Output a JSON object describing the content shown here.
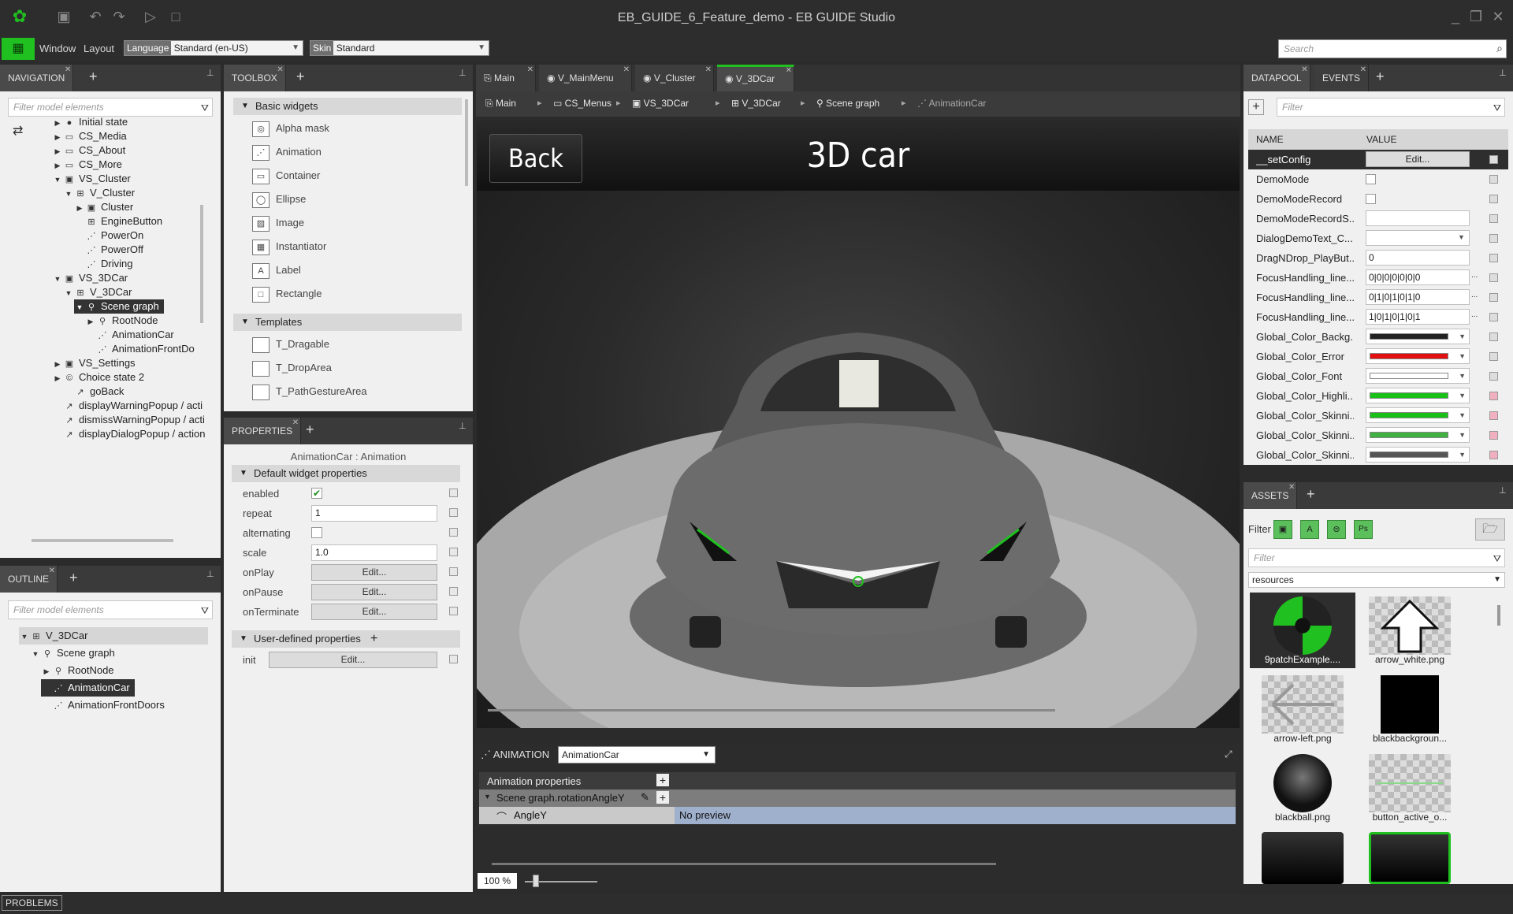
{
  "app": {
    "title": "EB_GUIDE_6_Feature_demo - EB GUIDE Studio"
  },
  "menubar": {
    "window": "Window",
    "layout": "Layout",
    "language_label": "Language",
    "language_value": "Standard (en-US)",
    "skin_label": "Skin",
    "skin_value": "Standard",
    "search_placeholder": "Search"
  },
  "navigation": {
    "tab": "NAVIGATION",
    "filter_placeholder": "Filter model elements",
    "items": [
      {
        "label": "Initial state"
      },
      {
        "label": "CS_Media"
      },
      {
        "label": "CS_About"
      },
      {
        "label": "CS_More"
      },
      {
        "label": "VS_Cluster"
      },
      {
        "label": "V_Cluster"
      },
      {
        "label": "Cluster"
      },
      {
        "label": "EngineButton"
      },
      {
        "label": "PowerOn"
      },
      {
        "label": "PowerOff"
      },
      {
        "label": "Driving"
      },
      {
        "label": "VS_3DCar"
      },
      {
        "label": "V_3DCar"
      },
      {
        "label": "Scene graph"
      },
      {
        "label": "RootNode"
      },
      {
        "label": "AnimationCar"
      },
      {
        "label": "AnimationFrontDo"
      },
      {
        "label": "VS_Settings"
      },
      {
        "label": "Choice state 2"
      },
      {
        "label": "goBack"
      },
      {
        "label": "displayWarningPopup / acti"
      },
      {
        "label": "dismissWarningPopup / acti"
      },
      {
        "label": "displayDialogPopup / action"
      }
    ]
  },
  "outline": {
    "tab": "OUTLINE",
    "filter_placeholder": "Filter model elements",
    "items": [
      {
        "label": "V_3DCar"
      },
      {
        "label": "Scene graph"
      },
      {
        "label": "RootNode"
      },
      {
        "label": "AnimationCar"
      },
      {
        "label": "AnimationFrontDoors"
      }
    ]
  },
  "toolbox": {
    "tab": "TOOLBOX",
    "basic_header": "Basic widgets",
    "basic": [
      "Alpha mask",
      "Animation",
      "Container",
      "Ellipse",
      "Image",
      "Instantiator",
      "Label",
      "Rectangle"
    ],
    "templates_header": "Templates",
    "templates": [
      "T_Dragable",
      "T_DropArea",
      "T_PathGestureArea"
    ]
  },
  "properties": {
    "tab": "PROPERTIES",
    "subtitle": "AnimationCar : Animation",
    "default_header": "Default widget properties",
    "rows": {
      "enabled": "enabled",
      "repeat": "repeat",
      "repeat_value": "1",
      "alternating": "alternating",
      "scale": "scale",
      "scale_value": "1.0",
      "onPlay": "onPlay",
      "onPause": "onPause",
      "onTerminate": "onTerminate",
      "edit": "Edit..."
    },
    "user_header": "User-defined properties",
    "init": "init"
  },
  "editor": {
    "tabs": [
      "Main",
      "V_MainMenu",
      "V_Cluster",
      "V_3DCar"
    ],
    "breadcrumb": [
      "Main",
      "CS_Menus",
      "VS_3DCar",
      "V_3DCar",
      "Scene graph",
      "AnimationCar"
    ],
    "back_label": "Back",
    "view_title": "3D car"
  },
  "animation": {
    "label": "ANIMATION",
    "selected": "AnimationCar",
    "props_header": "Animation properties",
    "track": "Scene graph.rotationAngleY",
    "subtrack": "AngleY",
    "preview": "No preview",
    "zoom": "100 %"
  },
  "datapool": {
    "tab": "DATAPOOL",
    "events_tab": "EVENTS",
    "filter_placeholder": "Filter",
    "col_name": "NAME",
    "col_value": "VALUE",
    "rows": [
      {
        "name": "__setConfig",
        "value": "Edit..."
      },
      {
        "name": "DemoMode",
        "value": ""
      },
      {
        "name": "DemoModeRecord",
        "value": ""
      },
      {
        "name": "DemoModeRecordS...",
        "value": ""
      },
      {
        "name": "DialogDemoText_C...",
        "value": ""
      },
      {
        "name": "DragNDrop_PlayBut...",
        "value": "0"
      },
      {
        "name": "FocusHandling_line...",
        "value": "0|0|0|0|0|0|0"
      },
      {
        "name": "FocusHandling_line...",
        "value": "0|1|0|1|0|1|0"
      },
      {
        "name": "FocusHandling_line...",
        "value": "1|0|1|0|1|0|1"
      },
      {
        "name": "Global_Color_Backg...",
        "value": ""
      },
      {
        "name": "Global_Color_Error",
        "value": ""
      },
      {
        "name": "Global_Color_Font",
        "value": ""
      },
      {
        "name": "Global_Color_Highli...",
        "value": ""
      },
      {
        "name": "Global_Color_Skinni...",
        "value": ""
      },
      {
        "name": "Global_Color_Skinni...",
        "value": ""
      },
      {
        "name": "Global_Color_Skinni...",
        "value": ""
      }
    ],
    "colors": [
      "#222222",
      "#e21010",
      "#ffffff",
      "#18c018",
      "#18c018",
      "#40b040",
      "#555555"
    ]
  },
  "assets": {
    "tab": "ASSETS",
    "filter_label": "Filter",
    "filter_placeholder": "Filter",
    "folder": "resources",
    "items": [
      {
        "label": "9patchExample...."
      },
      {
        "label": "arrow_white.png"
      },
      {
        "label": "arrow-left.png"
      },
      {
        "label": "blackbackgroun..."
      },
      {
        "label": "blackball.png"
      },
      {
        "label": "button_active_o..."
      }
    ]
  },
  "statusbar": {
    "problems": "PROBLEMS"
  },
  "accent": "#1fc01f"
}
